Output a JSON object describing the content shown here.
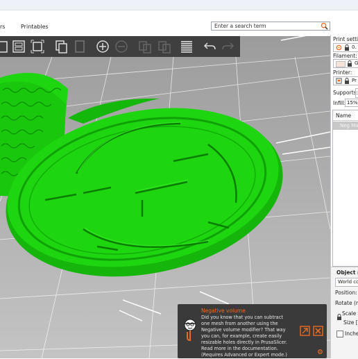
{
  "menu": {
    "items": [
      "rs",
      "Printables"
    ]
  },
  "search": {
    "placeholder": "Enter a search term"
  },
  "right_panel": {
    "print_settings_label": "Print setting",
    "print_settings_value": "0.",
    "filament_label": "Filament:",
    "filament_value": "G",
    "printer_label": "Printer:",
    "printer_value": "Pr",
    "supports_label": "Supports:",
    "infill_label": "Infill:",
    "infill_value": "15%",
    "list_header": "Name",
    "list_selected_item": "Neg Ma",
    "object_manip_label": "Object ma",
    "world_coords": "World co",
    "position_label": "Position:",
    "rotate_label": "Rotate (rel",
    "scale_label": "Scale f",
    "size_label": "Size [V",
    "inches_label": "Inches"
  },
  "hint": {
    "title": "Negative volume",
    "body": "Did you know that you can subtract one mesh from another using the Negative volume modifier? That way you can, for example, create easily resizable holes directly in PrusaSlicer. Read more in the documentation. (Requires Advanced or Expert mode.)"
  },
  "colors": {
    "model_green": "#1dd60f",
    "accent_orange": "#ed6b21",
    "bed_grey": "#adadad",
    "toolbar_dark": "#3f3f3f"
  },
  "icons": [
    "copy-icon",
    "arrange-icon",
    "arrange-selection-icon",
    "copy-objects-icon",
    "paste-icon",
    "add-instance-icon",
    "remove-instance-icon",
    "split-objects-icon",
    "split-parts-icon",
    "layers-editing-icon",
    "undo-icon",
    "redo-icon",
    "search-icon",
    "print-settings-icon",
    "lock-icon",
    "filament-color-icon",
    "printer-icon",
    "hint-mascot-icon",
    "documentation-icon",
    "close-icon"
  ]
}
